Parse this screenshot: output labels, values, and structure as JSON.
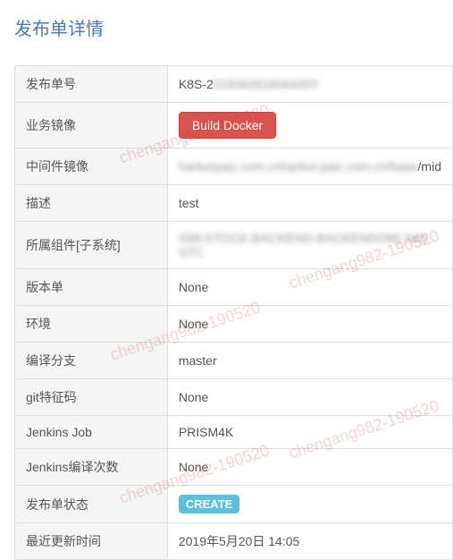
{
  "title": "发布单详情",
  "rows": {
    "release_id": {
      "label": "发布单号",
      "value_prefix": "K8S-2",
      "value_blur": "01906281806420Y"
    },
    "biz_image": {
      "label": "业务镜像",
      "button": "Build Docker"
    },
    "mid_image": {
      "label": "中间件镜像",
      "value_blur": "harborpaic.com.cnharbor.paic.com.cn/base",
      "value_suffix": "/mid"
    },
    "desc": {
      "label": "描述",
      "value": "test"
    },
    "component": {
      "label": "所属组件[子系统]",
      "value_blur": "S99-STOCK-BACKEND-BACKENDOM| S45-STC"
    },
    "version": {
      "label": "版本单",
      "value": "None"
    },
    "env": {
      "label": "环境",
      "value": "None"
    },
    "branch": {
      "label": "编译分支",
      "value": "master"
    },
    "git_tag": {
      "label": "git特征码",
      "value": "None"
    },
    "jenkins_job": {
      "label": "Jenkins Job",
      "value": "PRISM4K"
    },
    "jenkins_count": {
      "label": "Jenkins编译次数",
      "value": "None"
    },
    "status": {
      "label": "发布单状态",
      "badge": "CREATE"
    },
    "updated": {
      "label": "最近更新时间",
      "value": "2019年5月20日 14:05"
    }
  },
  "watermark": "chengang982-190520"
}
